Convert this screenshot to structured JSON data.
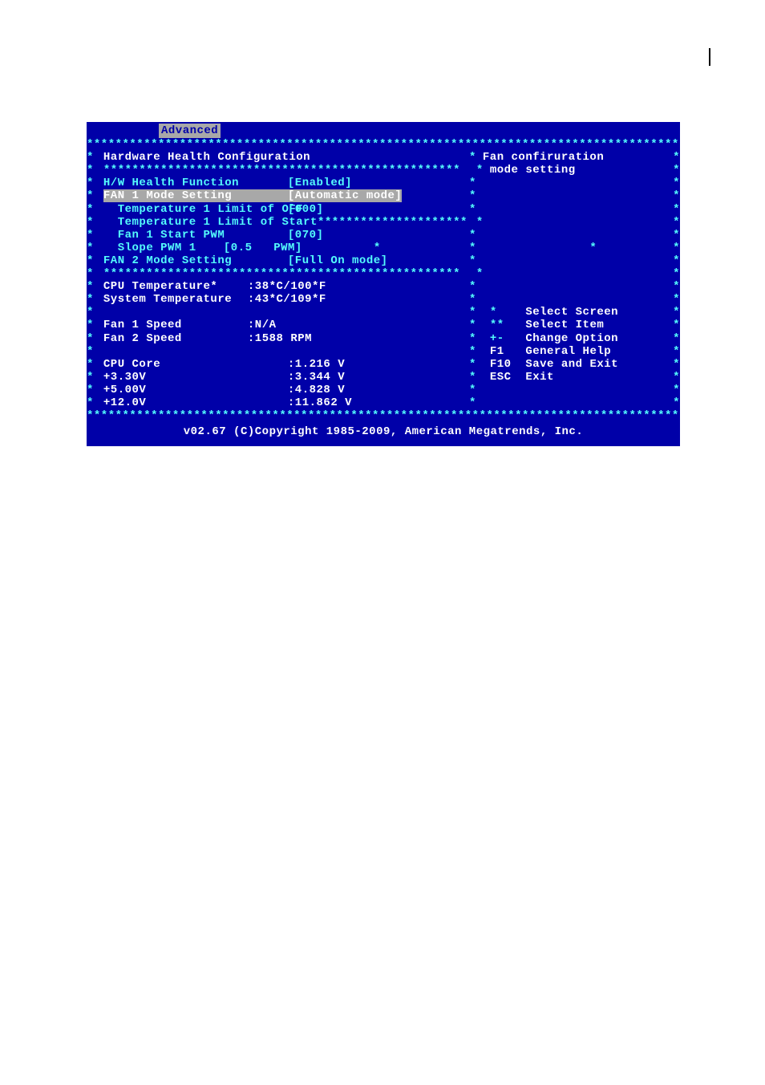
{
  "tab": "Advanced",
  "title": "Hardware Health Configuration",
  "help": {
    "line1": "Fan confiruration",
    "line2": "mode setting"
  },
  "settings": {
    "hw_health": {
      "label": "H/W Health Function",
      "value": "[Enabled]"
    },
    "fan1_mode": {
      "label": "FAN 1 Mode Setting",
      "value": "[Automatic mode]"
    },
    "temp_off": {
      "label": "  Temperature 1 Limit of OFF",
      "value": "[000]"
    },
    "temp_start": {
      "label": "  Temperature 1 Limit of Start"
    },
    "fan1_start_pwm": {
      "label": "  Fan 1 Start PWM",
      "value": "[070]"
    },
    "slope_pwm": {
      "label": "  Slope PWM 1",
      "value": "[0.5   PWM]"
    },
    "fan2_mode": {
      "label": "FAN 2 Mode Setting",
      "value": "[Full On mode]"
    }
  },
  "status": {
    "cpu_temp": {
      "label": "CPU Temperature*",
      "value": ":38*C/100*F"
    },
    "sys_temp": {
      "label": "System Temperature",
      "value": ":43*C/109*F"
    },
    "fan1_speed": {
      "label": "Fan 1 Speed",
      "value": ":N/A"
    },
    "fan2_speed": {
      "label": "Fan 2 Speed",
      "value": ":1588 RPM"
    },
    "cpu_core": {
      "label": "CPU Core",
      "value": ":1.216 V"
    },
    "v33": {
      "label": "+3.30V",
      "value": ":3.344 V"
    },
    "v5": {
      "label": "+5.00V",
      "value": ":4.828 V"
    },
    "v12": {
      "label": "+12.0V",
      "value": ":11.862 V"
    }
  },
  "nav": {
    "select_screen": {
      "key": "*",
      "label": "Select Screen"
    },
    "select_item": {
      "key": "**",
      "label": "Select Item"
    },
    "change_option": {
      "key": "+-",
      "label": "Change Option"
    },
    "general_help": {
      "key": "F1",
      "label": "General Help"
    },
    "save_exit": {
      "key": "F10",
      "label": "Save and Exit"
    },
    "exit": {
      "key": "ESC",
      "label": "Exit"
    }
  },
  "footer": "v02.67 (C)Copyright 1985-2009, American Megatrends, Inc."
}
